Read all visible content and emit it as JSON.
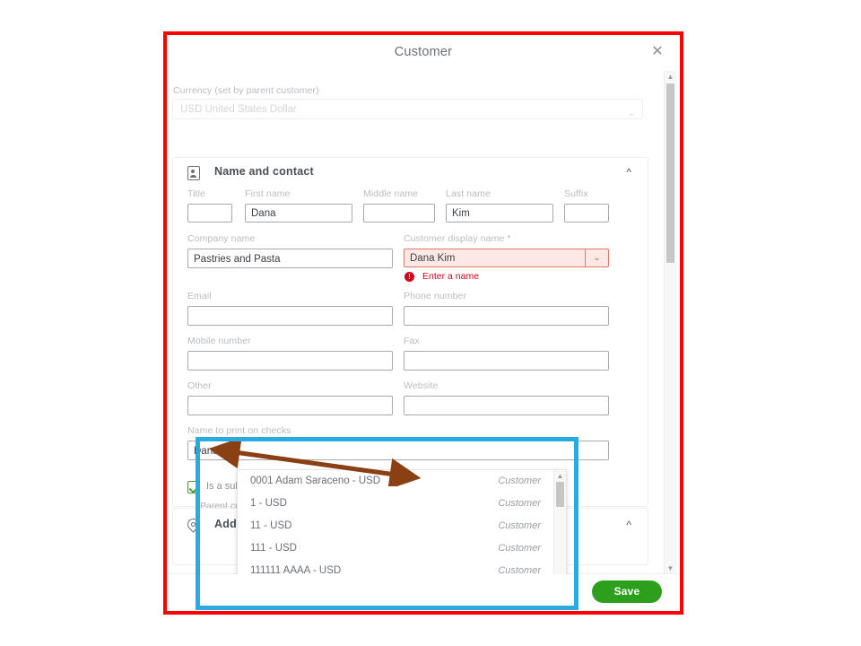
{
  "modal": {
    "title": "Customer",
    "close_icon": "close-icon"
  },
  "currency": {
    "label": "Currency (set by parent customer)",
    "value": "USD United States Dollar",
    "caret_icon": "chevron-down-icon"
  },
  "name_and_contact": {
    "title": "Name and contact",
    "icon": "contact-card-icon",
    "collapse_icon": "chevron-up-icon",
    "fields": {
      "title": {
        "label": "Title",
        "value": ""
      },
      "first_name": {
        "label": "First name",
        "value": "Dana"
      },
      "middle_name": {
        "label": "Middle name",
        "value": ""
      },
      "last_name": {
        "label": "Last name",
        "value": "Kim"
      },
      "suffix": {
        "label": "Suffix",
        "value": ""
      },
      "company_name": {
        "label": "Company name",
        "value": "Pastries and Pasta"
      },
      "display_name": {
        "label": "Customer display name *",
        "value": "Dana Kim",
        "error": "Enter a name",
        "error_icon": "error-exclamation-icon",
        "caret_icon": "chevron-down-icon"
      },
      "email": {
        "label": "Email",
        "value": ""
      },
      "phone_number": {
        "label": "Phone number",
        "value": ""
      },
      "mobile_number": {
        "label": "Mobile number",
        "value": ""
      },
      "fax": {
        "label": "Fax",
        "value": ""
      },
      "other": {
        "label": "Other",
        "value": ""
      },
      "website": {
        "label": "Website",
        "value": ""
      },
      "name_on_checks": {
        "label": "Name to print on checks",
        "value": "Dana Kim"
      }
    }
  },
  "sub_customer": {
    "checkbox_label": "Is a sub-customer",
    "checked": true,
    "check_icon": "checkmark-icon",
    "parent_label": "Parent customer",
    "parent_value": "",
    "caret_icon": "chevron-down-icon",
    "dropdown_options": [
      {
        "name": "0001 Adam Saraceno  - USD",
        "type": "Customer"
      },
      {
        "name": "1  - USD",
        "type": "Customer"
      },
      {
        "name": "11  - USD",
        "type": "Customer"
      },
      {
        "name": "111  - USD",
        "type": "Customer"
      },
      {
        "name": "111111 AAAA  - USD",
        "type": "Customer"
      }
    ]
  },
  "address": {
    "title": "Addre",
    "icon": "location-pin-icon",
    "collapse_icon": "chevron-up-icon"
  },
  "footer": {
    "save_label": "Save"
  },
  "annotations": {
    "red_box": "#ff0000",
    "blue_box": "#29abe2",
    "arrow": "#8a4012"
  },
  "scrollbars": {
    "up_arrow_icon": "triangle-up-icon",
    "down_arrow_icon": "triangle-down-icon"
  }
}
